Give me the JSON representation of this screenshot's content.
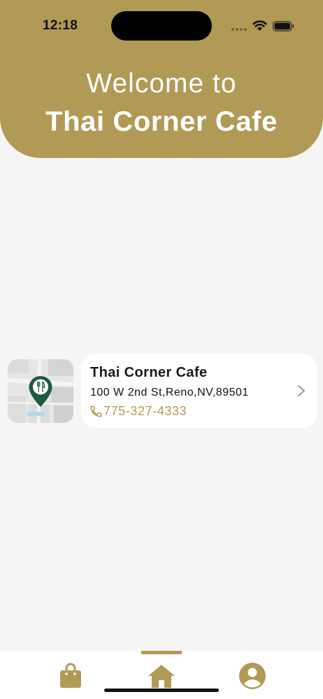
{
  "status_bar": {
    "time": "12:18"
  },
  "header": {
    "welcome": "Welcome to",
    "title": "Thai Corner Cafe"
  },
  "location": {
    "name": "Thai Corner Cafe",
    "address": "100 W 2nd St,Reno,NV,89501",
    "phone": "775-327-4333"
  },
  "tabs": {
    "active": "home",
    "items": [
      "bag-icon",
      "home-icon",
      "profile-icon"
    ]
  },
  "colors": {
    "brand": "#b09a55",
    "pin": "#1f5a3f",
    "background": "#f5f5f5"
  }
}
